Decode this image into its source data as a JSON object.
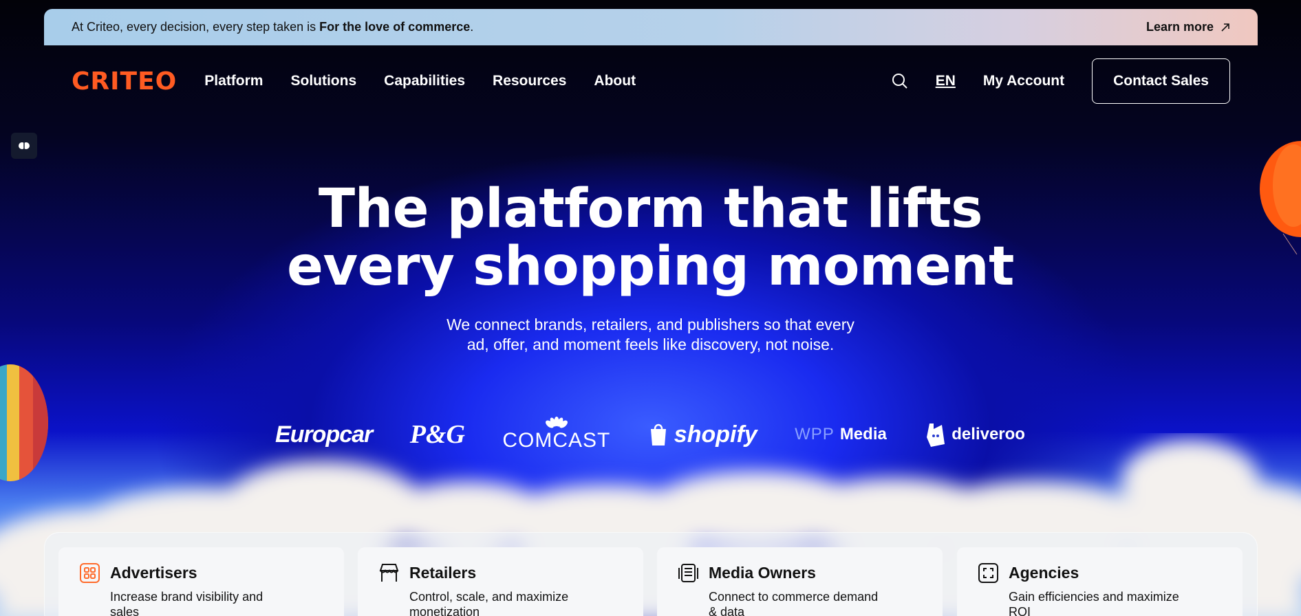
{
  "banner": {
    "text": "At Criteo, every decision, every step taken is ",
    "emphasis": "For the love of commerce",
    "period": ".",
    "learn_more": "Learn more",
    "learn_more_icon": "arrow-up-right-icon"
  },
  "nav": {
    "logo": "CRITEO",
    "links": [
      "Platform",
      "Solutions",
      "Capabilities",
      "Resources",
      "About"
    ],
    "search_icon": "search-icon",
    "language": "EN",
    "account": "My Account",
    "contact": "Contact Sales"
  },
  "ai_badge_icon": "brain-icon",
  "hero": {
    "title_line1": "The platform that lifts",
    "title_line2": "every shopping moment",
    "subtitle_line1": "We connect brands, retailers, and publishers so that every",
    "subtitle_line2": "ad, offer, and moment feels like discovery, not noise."
  },
  "logos": {
    "europcar": "Europcar",
    "pg": "P&G",
    "comcast": "COMCAST",
    "shopify": "shopify",
    "wpp_prefix": "WPP",
    "wpp_suffix": "Media",
    "deliveroo": "deliveroo"
  },
  "cards": [
    {
      "icon": "grid-icon",
      "title": "Advertisers",
      "desc": "Increase brand visibility and sales"
    },
    {
      "icon": "storefront-icon",
      "title": "Retailers",
      "desc": "Control, scale, and maximize monetization"
    },
    {
      "icon": "document-icon",
      "title": "Media Owners",
      "desc": "Connect to commerce demand & data"
    },
    {
      "icon": "focus-frame-icon",
      "title": "Agencies",
      "desc": "Gain efficiencies and maximize ROI"
    }
  ],
  "colors": {
    "brand_orange": "#ff5b22",
    "banner_start": "#a8cdea",
    "banner_end": "#f0c8c0",
    "hero_blue": "#0b12c8"
  }
}
